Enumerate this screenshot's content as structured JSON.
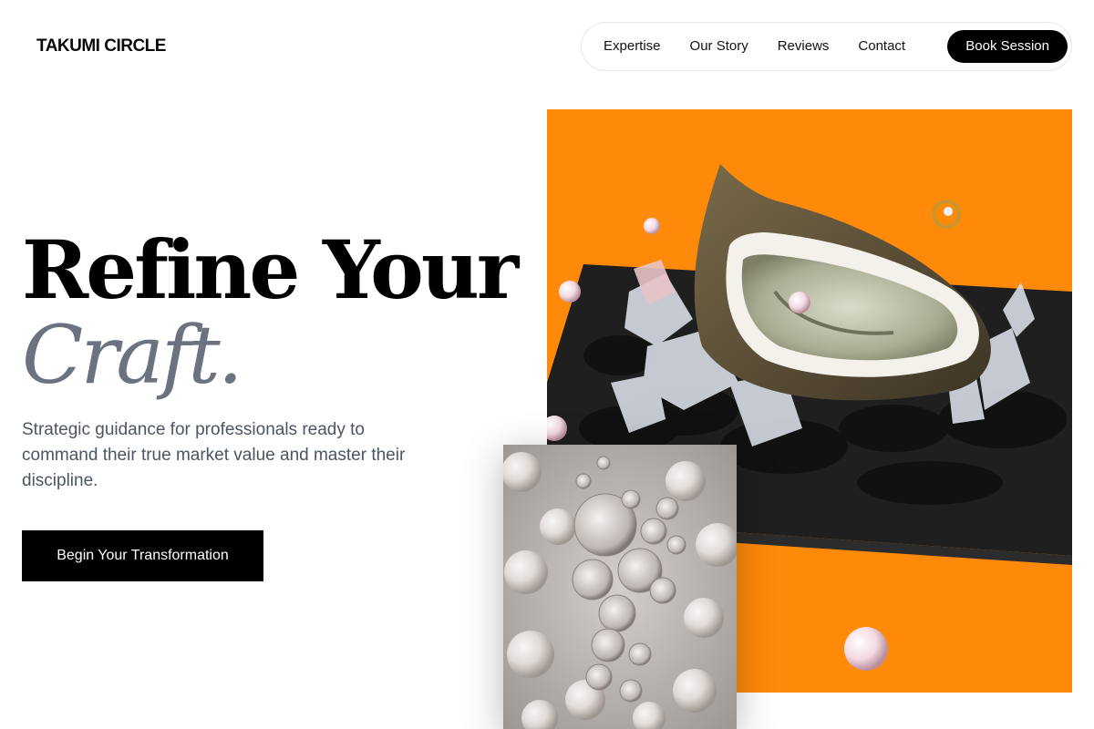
{
  "brand": {
    "name": "TAKUMI CIRCLE"
  },
  "nav": {
    "links": [
      "Expertise",
      "Our Story",
      "Reviews",
      "Contact"
    ],
    "cta": "Book Session"
  },
  "hero": {
    "line1": "Refine Your",
    "line2": "Craft.",
    "description": "Strategic guidance for professionals ready to command their true market value and master their discipline.",
    "cta": "Begin Your Transformation"
  },
  "colors": {
    "accent_orange": "#ff8a0a",
    "muted_heading": "#6b7280",
    "body_text": "#4b5563"
  }
}
